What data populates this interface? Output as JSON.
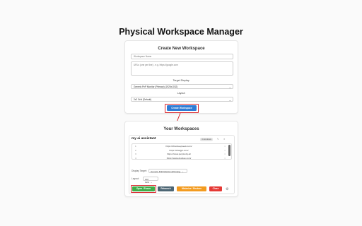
{
  "page": {
    "title": "Physical Workspace Manager"
  },
  "create": {
    "title": "Create New Workspace",
    "name_placeholder": "Workspace Name",
    "urls_placeholder": "URLs (one per line) - e.g. https://google.com",
    "target_label": "Target Display:",
    "target_value": "Generic PnP Monitor (Primary) (1920x1032)",
    "layout_label": "Layout:",
    "layout_value": "2x2 Grid (Default)",
    "create_button": "Create Workspace"
  },
  "list": {
    "title": "Your Workspaces",
    "workspace": {
      "name": "my ai assistant",
      "badge": "4 windows",
      "edit": "✎",
      "delete": "✕",
      "urls": [
        {
          "num": "1",
          "url": "https://chat.deepseek.com/"
        },
        {
          "num": "2",
          "url": "https://chatgpt.com/"
        },
        {
          "num": "3",
          "url": "https://www.perplexity.ai/"
        },
        {
          "num": "4",
          "url": "https://www.doubao.com/"
        }
      ],
      "display_label": "Display Target:",
      "display_value": "Generic PnP Monitor (Primary)",
      "layout_label": "Layout:",
      "layout_value": "2x2 Grid",
      "buttons": {
        "open": "Open / Focus",
        "relaunch": "Relaunch",
        "minimize": "Minimize / Restore",
        "close": "Close"
      }
    }
  },
  "colors": {
    "primary": "#2e7cd6",
    "open": "#3fae49",
    "relaunch": "#4d6674",
    "minimize": "#f39b1f",
    "close": "#e53935",
    "highlight": "#d9252c"
  },
  "icons": {
    "chevron": "chevron-down-icon",
    "settings": "gear-icon"
  }
}
